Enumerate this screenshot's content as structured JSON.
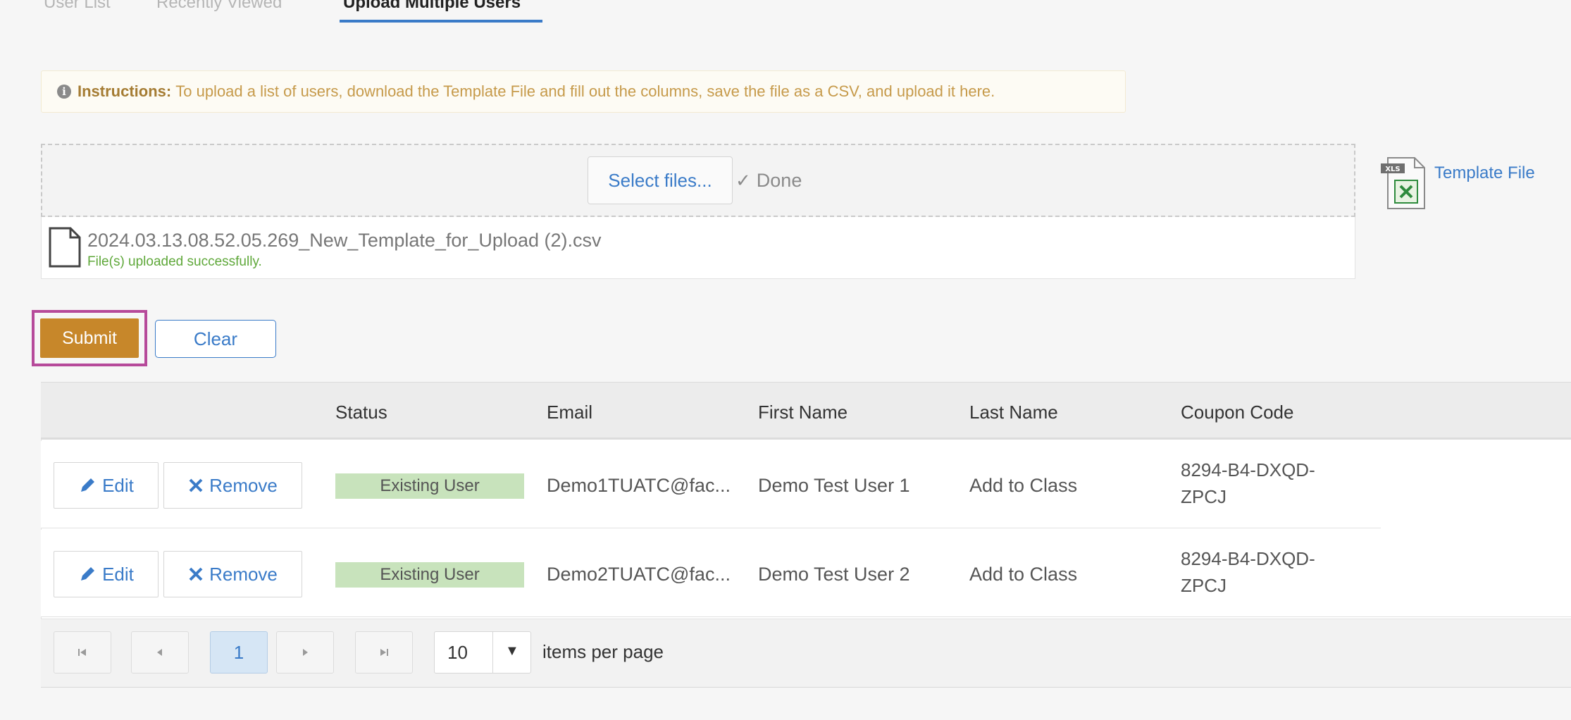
{
  "tabs": [
    {
      "label": "User List",
      "active": false
    },
    {
      "label": "Recently Viewed",
      "active": false
    },
    {
      "label": "Upload Multiple Users",
      "active": true
    }
  ],
  "instructions": {
    "icon": "info-icon",
    "title": "Instructions:",
    "text": "To upload a list of users, download the Template File and fill out the columns, save the file as a CSV, and upload it here."
  },
  "upload": {
    "select_label": "Select files...",
    "done_label": "Done",
    "file_name": "2024.03.13.08.52.05.269_New_Template_for_Upload (2).csv",
    "file_status": "File(s) uploaded successfully."
  },
  "template": {
    "icon_text": "XLS",
    "link_label": "Template File"
  },
  "buttons": {
    "submit": "Submit",
    "clear": "Clear"
  },
  "grid": {
    "columns": [
      "Status",
      "Email",
      "First Name",
      "Last Name",
      "Coupon Code"
    ],
    "edit_label": "Edit",
    "remove_label": "Remove",
    "rows": [
      {
        "status": "Existing User",
        "email": "Demo1TUATC@fac...",
        "first_name": "Demo Test User 1",
        "last_name": "Add to Class",
        "coupon": "8294-B4-DXQD-ZPCJ"
      },
      {
        "status": "Existing User",
        "email": "Demo2TUATC@fac...",
        "first_name": "Demo Test User 2",
        "last_name": "Add to Class",
        "coupon": "8294-B4-DXQD-ZPCJ"
      }
    ]
  },
  "pager": {
    "current_page": "1",
    "page_size": "10",
    "items_per_page": "items per page"
  },
  "colors": {
    "accent": "#3a7bc8",
    "submit": "#c7872a",
    "highlight": "#b64a9a",
    "badge": "#c8e3bc"
  }
}
